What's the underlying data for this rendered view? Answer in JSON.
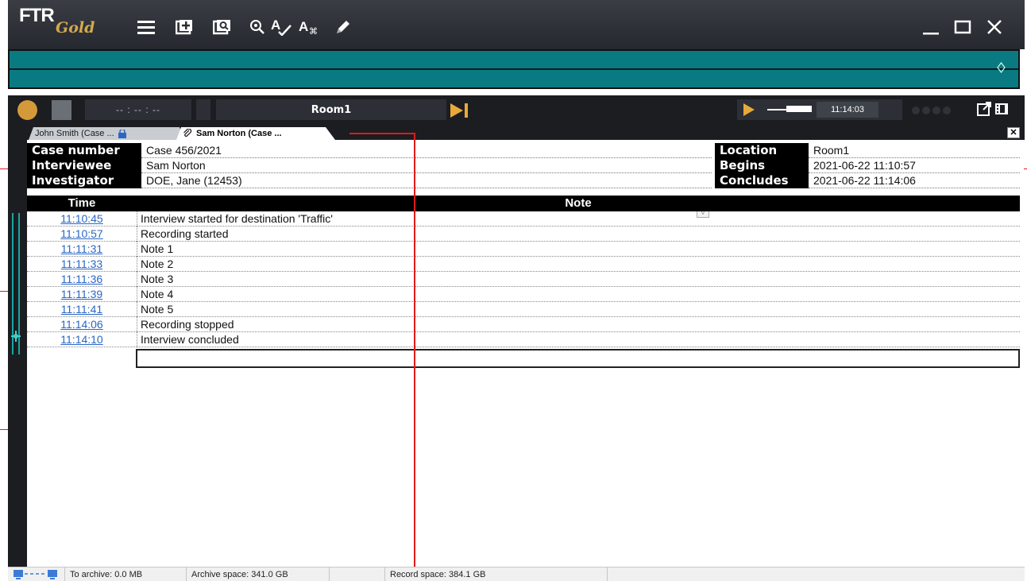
{
  "app": {
    "logo": "FTR",
    "logo_sub": "Gold",
    "toolbar_icons": [
      "menu-icon",
      "add-case-icon",
      "search-doc-icon",
      "zoom-icon",
      "spellcheck-icon",
      "text-format-icon",
      "pen-icon"
    ],
    "window_icons": [
      "minimize-icon",
      "maximize-icon",
      "close-icon"
    ]
  },
  "transport": {
    "time_display": "-- : -- : --",
    "room": "Room1",
    "clock": "11:14:03"
  },
  "tabs": [
    {
      "label": "John Smith (Case ..."
    },
    {
      "label": "Sam Norton (Case ..."
    }
  ],
  "tab_close": "✕",
  "header": {
    "case_number_label": "Case number",
    "case_number": "Case 456/2021",
    "interviewee_label": "Interviewee",
    "interviewee": "Sam Norton",
    "investigator_label": "Investigator",
    "investigator": "DOE, Jane (12453)",
    "location_label": "Location",
    "location": "Room1",
    "begins_label": "Begins",
    "begins": "2021-06-22 11:10:57",
    "concludes_label": "Concludes",
    "concludes": "2021-06-22 11:14:06"
  },
  "notes": {
    "time_header": "Time",
    "note_header": "Note",
    "rows": [
      {
        "time": "11:10:45",
        "note": "Interview started for destination 'Traffic'"
      },
      {
        "time": "11:10:57",
        "note": "Recording started"
      },
      {
        "time": "11:11:31",
        "note": "Note 1"
      },
      {
        "time": "11:11:33",
        "note": "Note 2"
      },
      {
        "time": "11:11:36",
        "note": "Note 3"
      },
      {
        "time": "11:11:39",
        "note": "Note 4"
      },
      {
        "time": "11:11:41",
        "note": "Note 5"
      },
      {
        "time": "11:14:06",
        "note": "Recording stopped"
      },
      {
        "time": "11:14:10",
        "note": "Interview concluded"
      }
    ],
    "new_note_value": ""
  },
  "status": {
    "to_archive": "To archive: 0.0 MB",
    "archive_space": "Archive space: 341.0 GB",
    "record_space": "Record space: 384.1 GB"
  },
  "colors": {
    "timeline": "#0a7a82",
    "accent_orange": "#d49a3a",
    "link_blue": "#2a67c4",
    "guide_red": "#e01b1b"
  }
}
